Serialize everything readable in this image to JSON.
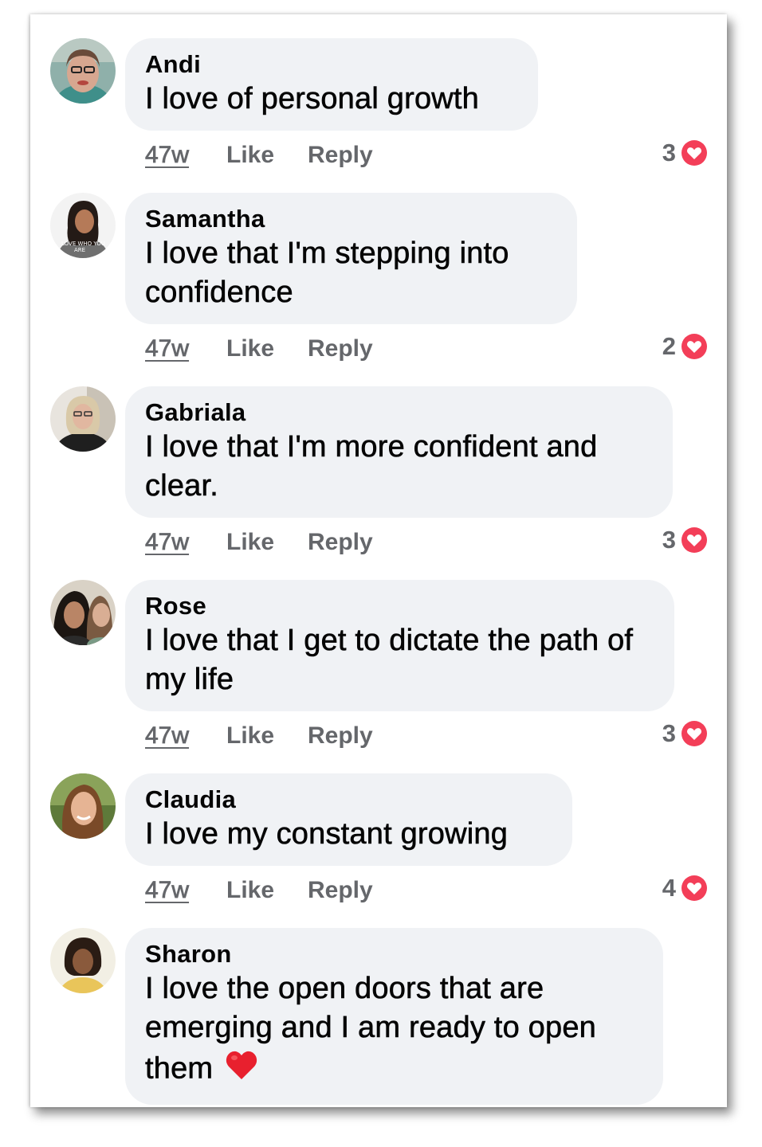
{
  "comments": [
    {
      "name": "Andi",
      "text": "I love of personal growth",
      "time": "47w",
      "like_label": "Like",
      "reply_label": "Reply",
      "reaction_count": "3",
      "avatar": "avatar-andi"
    },
    {
      "name": "Samantha",
      "text": "I love that I'm stepping into confidence",
      "time": "47w",
      "like_label": "Like",
      "reply_label": "Reply",
      "reaction_count": "2",
      "avatar": "avatar-samantha"
    },
    {
      "name": "Gabriala",
      "text": "I love that I'm more confident and clear.",
      "time": "47w",
      "like_label": "Like",
      "reply_label": "Reply",
      "reaction_count": "3",
      "avatar": "avatar-gabriala"
    },
    {
      "name": "Rose",
      "text": "I love that I get to dictate the path of my life",
      "time": "47w",
      "like_label": "Like",
      "reply_label": "Reply",
      "reaction_count": "3",
      "avatar": "avatar-rose"
    },
    {
      "name": "Claudia",
      "text": "I love my constant growing",
      "time": "47w",
      "like_label": "Like",
      "reply_label": "Reply",
      "reaction_count": "4",
      "avatar": "avatar-claudia"
    },
    {
      "name": "Sharon",
      "text": "I love the open doors that are emerging and I am ready to open them",
      "emoji": "red-heart",
      "avatar": "avatar-sharon"
    }
  ],
  "colors": {
    "bubble": "#f0f2f5",
    "text": "#050505",
    "meta": "#65676b",
    "love": "#f33e58"
  },
  "icons": {
    "reaction": "love-reaction-icon",
    "emoji": "red-heart-emoji"
  }
}
